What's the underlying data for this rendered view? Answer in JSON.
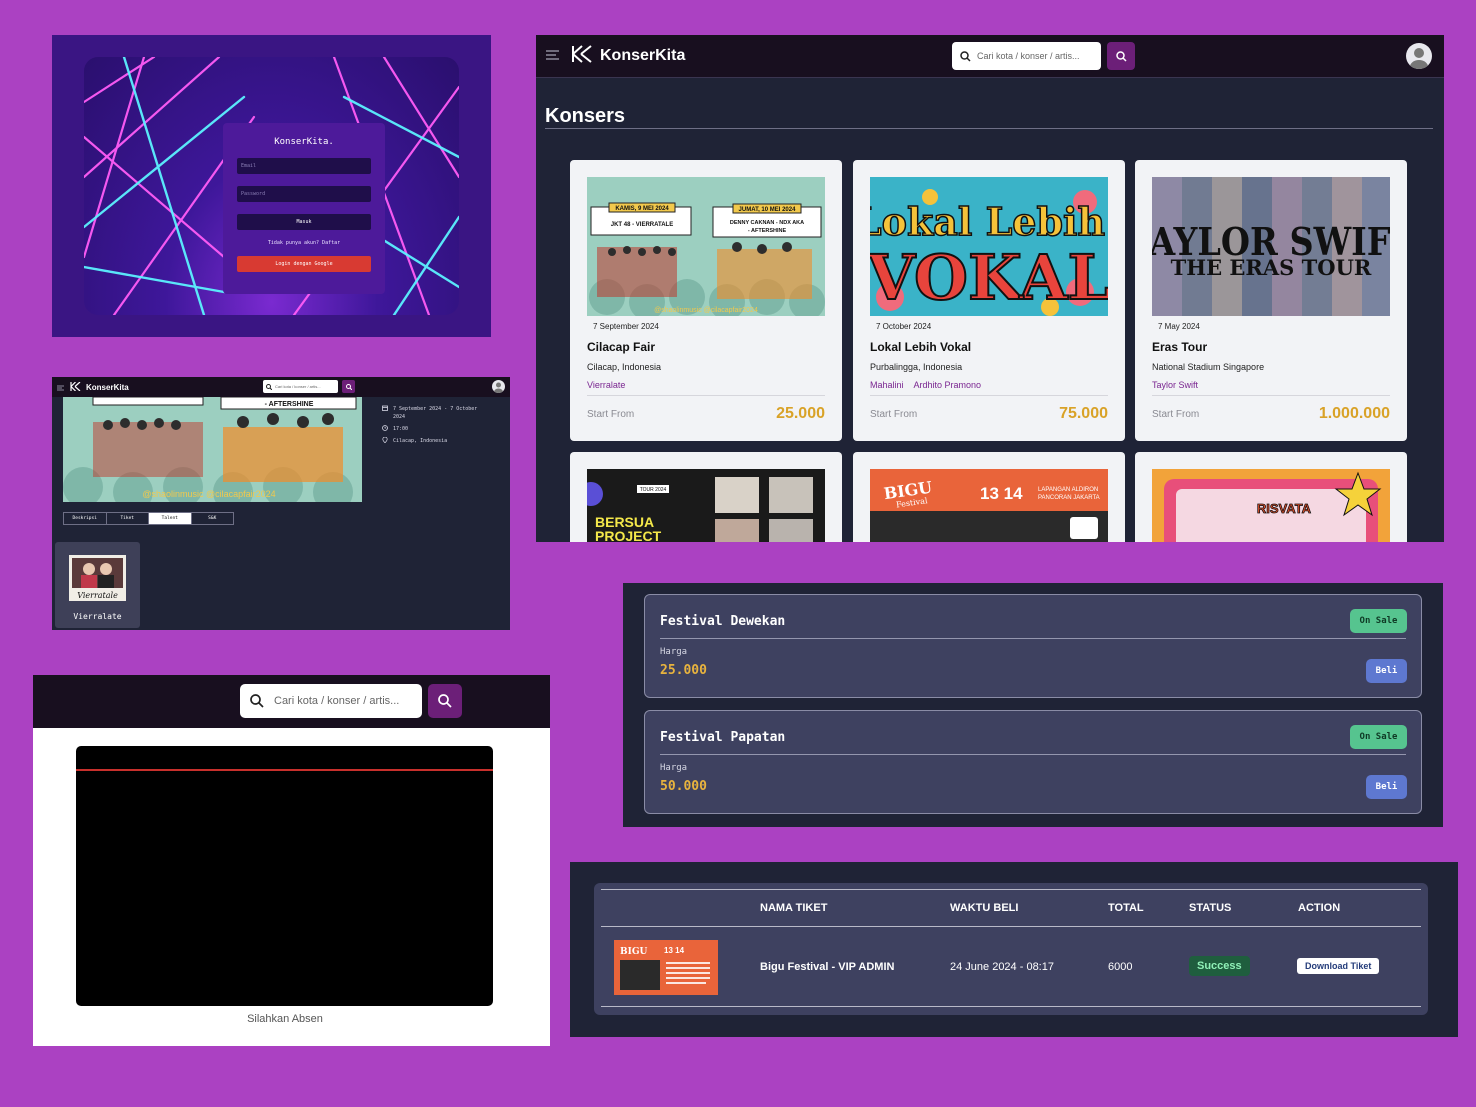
{
  "brand": "KonserKita",
  "login": {
    "brand": "KonserKita.",
    "email_placeholder": "Email",
    "password_placeholder": "Password",
    "submit_label": "Masuk",
    "register_text": "Tidak punya akun? Daftar",
    "google_label": "Login dengan Google"
  },
  "search": {
    "placeholder": "Cari kota / konser / artis..."
  },
  "list": {
    "heading": "Konsers",
    "price_label": "Start From",
    "cards": [
      {
        "date": "7 September 2024",
        "name": "Cilacap Fair",
        "location": "Cilacap, Indonesia",
        "talents": [
          "Vierralate"
        ],
        "price": "25.000",
        "poster_texts": [
          "KAMIS, 9 MEI 2024",
          "JUMAT, 10 MEI 2024",
          "JKT 48 - VIERRATALE",
          "DENNY CAKNAN - NDX AKA - AFTERSHINE",
          "@shaolinmusic @cilacapfair2024"
        ]
      },
      {
        "date": "7 October 2024",
        "name": "Lokal Lebih Vokal",
        "location": "Purbalingga, Indonesia",
        "talents": [
          "Mahalini",
          "Ardhito Pramono"
        ],
        "price": "75.000",
        "poster_texts": [
          "Lokal",
          "Lebih",
          "VOKAL"
        ]
      },
      {
        "date": "7 May 2024",
        "name": "Eras Tour",
        "location": "National Stadium Singapore",
        "talents": [
          "Taylor Swift"
        ],
        "price": "1.000.000",
        "poster_texts": [
          "TAYLOR SWIFT",
          "THE ERAS TOUR"
        ]
      }
    ],
    "partial_posters": [
      "BERSUA PROJECT",
      "TOUR 2024",
      "BIGU Festival",
      "13 14",
      "LAPANGAN ALDIRON PANCORAN JAKARTA",
      "RISVATA"
    ]
  },
  "detail": {
    "hero_tag": "- AFTERSHINE",
    "hero_caption": "@shaolinmusic @cilacapfair2024",
    "date": "7 September 2024 - 7 October 2024",
    "time": "17:00",
    "location": "Cilacap, Indonesia",
    "tabs": [
      "Deskripsi",
      "Tiket",
      "Talent",
      "S&K"
    ],
    "active_tab": "Talent",
    "talent": {
      "name": "Vierralate",
      "logo": "Vierratale"
    }
  },
  "absen": {
    "caption": "Silahkan Absen"
  },
  "tickets": [
    {
      "name": "Festival Dewekan",
      "status": "On Sale",
      "price_label": "Harga",
      "price": "25.000",
      "buy_label": "Beli"
    },
    {
      "name": "Festival Papatan",
      "status": "On Sale",
      "price_label": "Harga",
      "price": "50.000",
      "buy_label": "Beli"
    }
  ],
  "history": {
    "columns": [
      "NAMA TIKET",
      "WAKTU BELI",
      "TOTAL",
      "STATUS",
      "ACTION"
    ],
    "rows": [
      {
        "name": "Bigu Festival - VIP ADMIN",
        "time": "24 June 2024 - 08:17",
        "total": "6000",
        "status": "Success",
        "action": "Download Tiket"
      }
    ]
  },
  "colors": {
    "background": "#ab41c2",
    "navbar": "#180f1f",
    "panel": "#1f2336",
    "accent_purple": "#6c1f78",
    "price": "#d9a227",
    "on_sale": "#56c48f",
    "buy": "#5e78d0",
    "google": "#d83a32"
  },
  "icons": [
    "menu-icon",
    "logo-icon",
    "search-icon",
    "user-avatar",
    "calendar-icon",
    "clock-icon",
    "location-pin-icon"
  ]
}
